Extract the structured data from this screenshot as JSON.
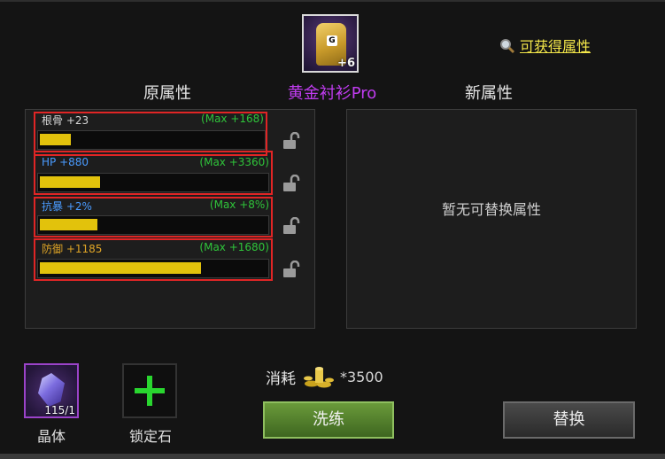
{
  "item": {
    "name": "黄金衬衫Pro",
    "plus_level": "+6",
    "badge_letter": "G"
  },
  "link_text": "可获得属性",
  "headers": {
    "original": "原属性",
    "new": "新属性"
  },
  "attributes": [
    {
      "label": "根骨 +23",
      "max": "(Max +168)",
      "label_color": "#d6d6d6",
      "fill": 0.137
    },
    {
      "label": "HP +880",
      "max": "(Max +3360)",
      "label_color": "#4a9bff",
      "fill": 0.262
    },
    {
      "label": "抗暴 +2%",
      "max": "(Max +8%)",
      "label_color": "#4a9bff",
      "fill": 0.25
    },
    {
      "label": "防御 +1185",
      "max": "(Max +1680)",
      "label_color": "#e0a526",
      "fill": 0.705
    }
  ],
  "empty_message": "暂无可替换属性",
  "crystal": {
    "label": "晶体",
    "count": "115/1"
  },
  "lockstone": {
    "label": "锁定石"
  },
  "cost": {
    "label": "消耗",
    "value": "*3500"
  },
  "buttons": {
    "wash": "洗练",
    "replace": "替换"
  },
  "colors": {
    "highlight_border": "#e02525",
    "bar_fill": "#e2c20c",
    "max_text": "#2fc43a",
    "item_name": "#c03cf0",
    "link": "#f5e84a"
  }
}
